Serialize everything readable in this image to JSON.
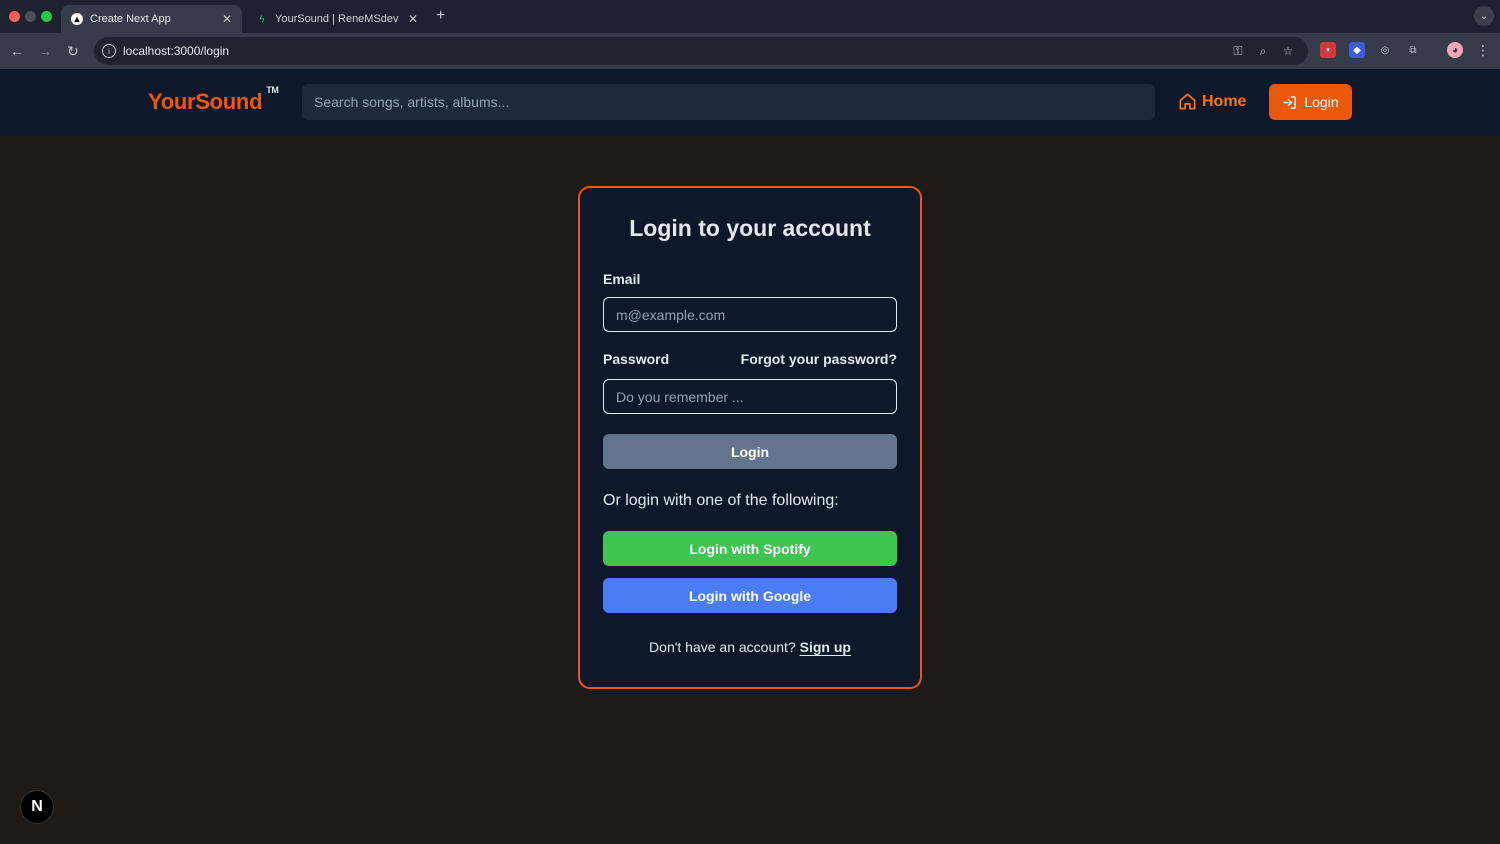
{
  "browser": {
    "tabs": [
      {
        "title": "Create Next App",
        "active": true,
        "favicon": "nextjs-triangle-icon"
      },
      {
        "title": "YourSound | ReneMSdev | Sup",
        "active": false,
        "favicon": "supabase-bolt-icon"
      }
    ],
    "url": "localhost:3000/login"
  },
  "header": {
    "logo": "YourSound",
    "trademark": "TM",
    "search_placeholder": "Search songs, artists, albums...",
    "home_label": "Home",
    "login_label": "Login"
  },
  "login_card": {
    "title": "Login to your account",
    "email_label": "Email",
    "email_placeholder": "m@example.com",
    "password_label": "Password",
    "forgot_label": "Forgot your password?",
    "password_placeholder": "Do you remember ...",
    "submit_label": "Login",
    "or_text": "Or login with one of the following:",
    "spotify_label": "Login with Spotify",
    "google_label": "Login with Google",
    "no_account_text": "Don't have an account? ",
    "signup_label": "Sign up"
  },
  "next_badge": "N",
  "colors": {
    "accent": "#ea580c",
    "header_bg": "#0f172a",
    "page_bg": "#1e1a17",
    "spotify": "#3dc451",
    "google": "#4b7cf5",
    "submit": "#64748b"
  }
}
